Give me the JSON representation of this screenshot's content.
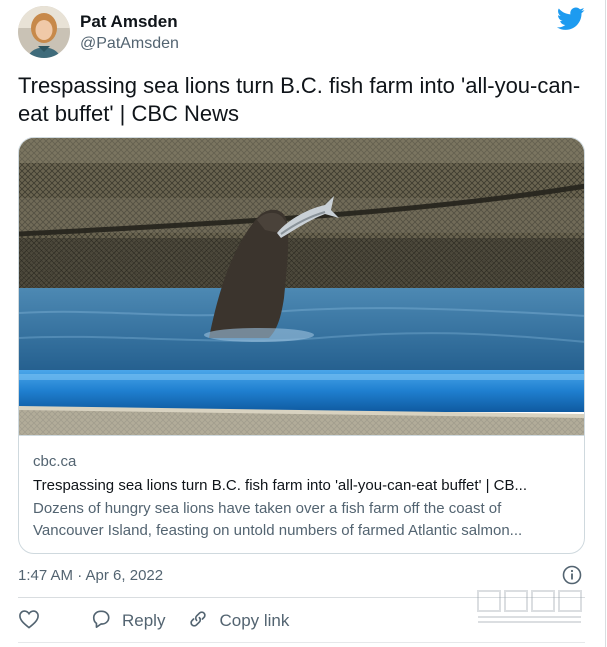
{
  "author": {
    "name": "Pat Amsden",
    "handle": "@PatAmsden"
  },
  "tweet": {
    "text": "Trespassing sea lions turn B.C. fish farm into 'all-you-can-eat buffet' | CBC News",
    "timestamp": "1:47 AM · Apr 6, 2022"
  },
  "link_card": {
    "domain": "cbc.ca",
    "title": "Trespassing sea lions turn B.C. fish farm into 'all-you-can-eat buffet' | CB...",
    "description": "Dozens of hungry sea lions have taken over a fish farm off the coast of Vancouver Island, feasting on untold numbers of farmed Atlantic salmon..."
  },
  "actions": {
    "reply_label": "Reply",
    "copy_link_label": "Copy link"
  },
  "icons": {
    "brand": "twitter-bird-icon",
    "info": "info-icon",
    "like": "heart-icon",
    "reply": "speech-bubble-icon",
    "copy_link": "link-icon"
  },
  "colors": {
    "twitter_blue": "#1d9bf0",
    "text_primary": "#0f1419",
    "text_secondary": "#536471",
    "border": "#cfd9de"
  }
}
